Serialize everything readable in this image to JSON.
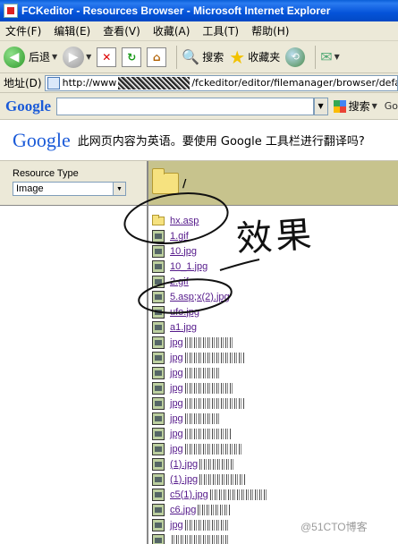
{
  "window": {
    "title": "FCKeditor - Resources Browser - Microsoft Internet Explorer"
  },
  "menu": {
    "items": [
      "文件(F)",
      "编辑(E)",
      "查看(V)",
      "收藏(A)",
      "工具(T)",
      "帮助(H)"
    ]
  },
  "toolbar": {
    "back_label": "后退",
    "search_label": "搜索",
    "favorites_label": "收藏夹"
  },
  "address": {
    "label": "地址(D)",
    "url_prefix": "http://www",
    "url_suffix": "/fckeditor/editor/filemanager/browser/default/br"
  },
  "google_toolbar": {
    "logo": "Google",
    "search_label": "搜索",
    "more": "Go"
  },
  "translate_bar": {
    "logo": "Google",
    "message": "此网页内容为英语。要使用 Google 工具栏进行翻译吗?"
  },
  "resource_type": {
    "label": "Resource Type",
    "selected": "Image"
  },
  "folder_path": "/",
  "files": [
    {
      "name": "hx.asp",
      "type": "folder"
    },
    {
      "name": "1.gif",
      "type": "file"
    },
    {
      "name": "10.jpg",
      "type": "file"
    },
    {
      "name": "10_1.jpg",
      "type": "file"
    },
    {
      "name": "2.gif",
      "type": "file"
    },
    {
      "name": "5.asp;x(2).jpg",
      "type": "file"
    },
    {
      "name": "ufo.jpg",
      "type": "file"
    },
    {
      "name": "a1.jpg",
      "type": "file"
    },
    {
      "name": "jpg",
      "type": "file"
    },
    {
      "name": "jpg",
      "type": "file"
    },
    {
      "name": "jpg",
      "type": "file"
    },
    {
      "name": "jpg",
      "type": "file"
    },
    {
      "name": "jpg",
      "type": "file"
    },
    {
      "name": "jpg",
      "type": "file"
    },
    {
      "name": "jpg",
      "type": "file"
    },
    {
      "name": "jpg",
      "type": "file"
    },
    {
      "name": "(1).jpg",
      "type": "file"
    },
    {
      "name": "(1).jpg",
      "type": "file"
    },
    {
      "name": "c5(1).jpg",
      "type": "file"
    },
    {
      "name": "c6.jpg",
      "type": "file"
    },
    {
      "name": "jpg",
      "type": "file"
    },
    {
      "name": "",
      "type": "file"
    }
  ],
  "annotation": {
    "handwriting": "效果"
  },
  "watermark": "@51CTO博客"
}
